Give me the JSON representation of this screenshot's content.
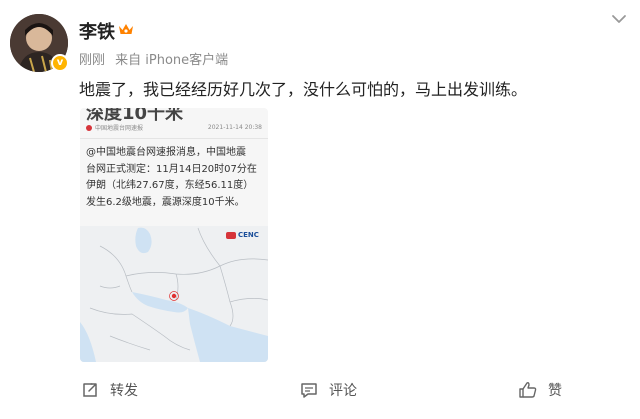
{
  "post": {
    "author": {
      "name": "李铁",
      "avatar_badge": "v",
      "crown_icon": "crown-icon"
    },
    "meta": {
      "time": "刚刚",
      "source": "来自 iPhone客户端"
    },
    "text": "地震了，我已经经历好几次了，没什么可怕的，马上出发训练。",
    "image_card": {
      "headline": "深度10千米",
      "source": "中国地震台网速报",
      "timestamp": "2021-11-14 20:38",
      "body_lines": [
        "@中国地震台网速报消息，中国地震",
        "台网正式测定：11月14日20时07分在",
        "伊朗（北纬27.67度，东经56.11度）",
        "发生6.2级地震，震源深度10千米。"
      ],
      "map_logo": "CENC"
    },
    "actions": {
      "repost": "转发",
      "comment": "评论",
      "like": "赞"
    },
    "colors": {
      "accent": "#ff8200",
      "verified_badge": "#ffb400",
      "text_primary": "#222222",
      "text_secondary": "#8a8a8a"
    }
  }
}
